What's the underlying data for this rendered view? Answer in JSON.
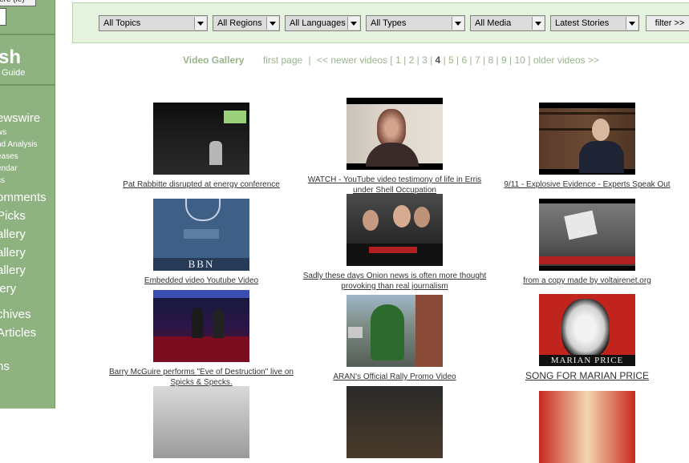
{
  "sidebar": {
    "top_button_label": "ere (ie)",
    "logo_text": "sh",
    "guide_text": "Guide",
    "items": [
      {
        "label": "ewswire",
        "size": "big"
      },
      {
        "label": "ws",
        "size": "small"
      },
      {
        "label": "nd Analysis",
        "size": "small"
      },
      {
        "label": "eases",
        "size": "small"
      },
      {
        "label": "endar",
        "size": "small"
      },
      {
        "label": "ss",
        "size": "small"
      },
      {
        "label": "omments",
        "size": "big"
      },
      {
        "label": "Picks",
        "size": "big"
      },
      {
        "label": "allery",
        "size": "big"
      },
      {
        "label": "allery",
        "size": "big"
      },
      {
        "label": "allery",
        "size": "big"
      },
      {
        "label": "lery",
        "size": "big"
      },
      {
        "label": "chives",
        "size": "big"
      },
      {
        "label": "Articles",
        "size": "big"
      },
      {
        "label": "ns",
        "size": "big"
      }
    ]
  },
  "filters": {
    "topics": "All Topics",
    "regions": "All Regions",
    "languages": "All Languages",
    "types": "All Types",
    "media": "All Media",
    "sort": "Latest Stories",
    "button_label": "filter >>"
  },
  "pager": {
    "title": "Video Gallery",
    "first_page": "first page",
    "sep": "|",
    "newer": "<< newer videos",
    "open_bracket": "[",
    "close_bracket": "]",
    "pages": [
      "1",
      "2",
      "3",
      "4",
      "5",
      "6",
      "7",
      "8",
      "9",
      "10"
    ],
    "current_page": "4",
    "older": "older videos >>"
  },
  "videos": [
    {
      "caption": "Pat Rabbitte disrupted at energy conference",
      "thumb": "rabbitte"
    },
    {
      "caption": "WATCH - YouTube video testimony of life in Erris under Shell Occupation",
      "thumb": "erris"
    },
    {
      "caption": "9/11 - Explosive Evidence - Experts Speak Out",
      "thumb": "911"
    },
    {
      "caption": "Embedded video Youtube Video",
      "thumb": "youtube",
      "overlay": "BBN"
    },
    {
      "caption": "Sadly these days Onion news is often more thought provoking than real journalism",
      "thumb": "onion"
    },
    {
      "caption": "from a copy made by voltairenet.org",
      "thumb": "voltaire"
    },
    {
      "caption": "Barry McGuire performs \"Eve of Destruction\" live on Spicks & Specks.",
      "thumb": "mcguire"
    },
    {
      "caption": "ARAN's Official Rally Promo Video",
      "thumb": "aran"
    },
    {
      "caption": "SONG FOR MARIAN PRICE",
      "thumb": "marian",
      "overlay": "MARIAN PRICE"
    }
  ]
}
